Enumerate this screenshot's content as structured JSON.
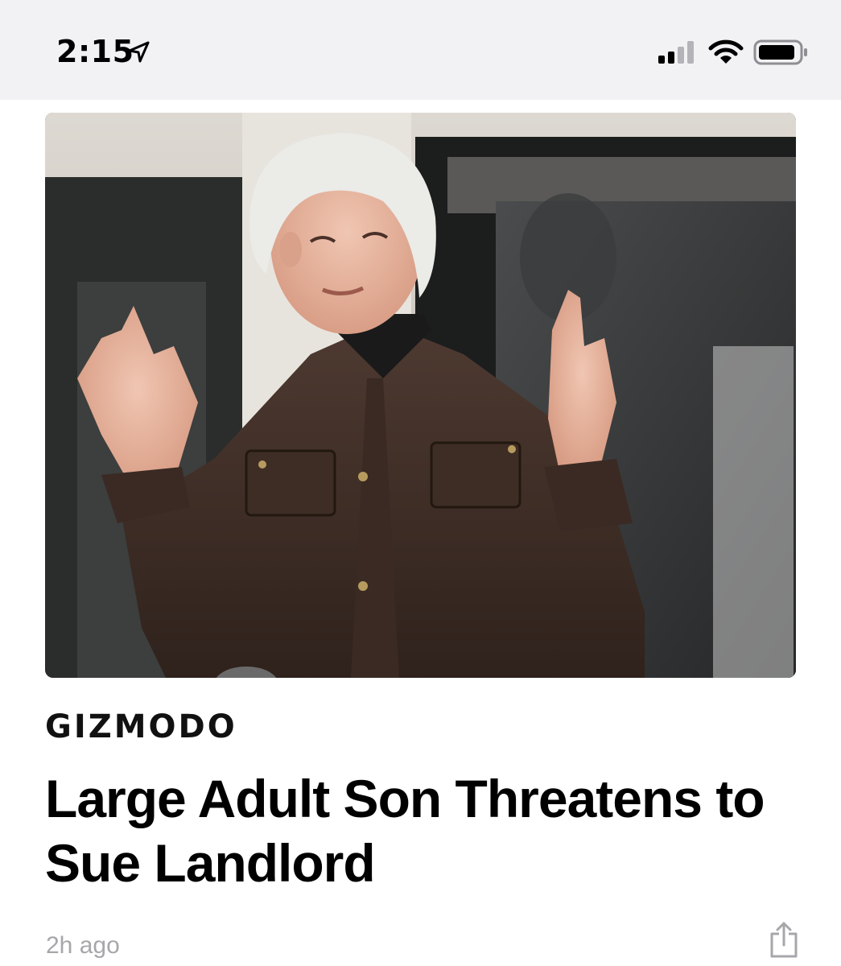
{
  "status_bar": {
    "time": "2:15",
    "location_icon": "location-arrow-icon",
    "signal_icon": "cellular-signal-icon",
    "wifi_icon": "wifi-icon",
    "battery_icon": "battery-icon"
  },
  "article": {
    "publisher": "GIZMODO",
    "headline": "Large Adult Son Threatens to Sue Landlord",
    "timestamp": "2h ago",
    "share_icon": "share-icon"
  }
}
